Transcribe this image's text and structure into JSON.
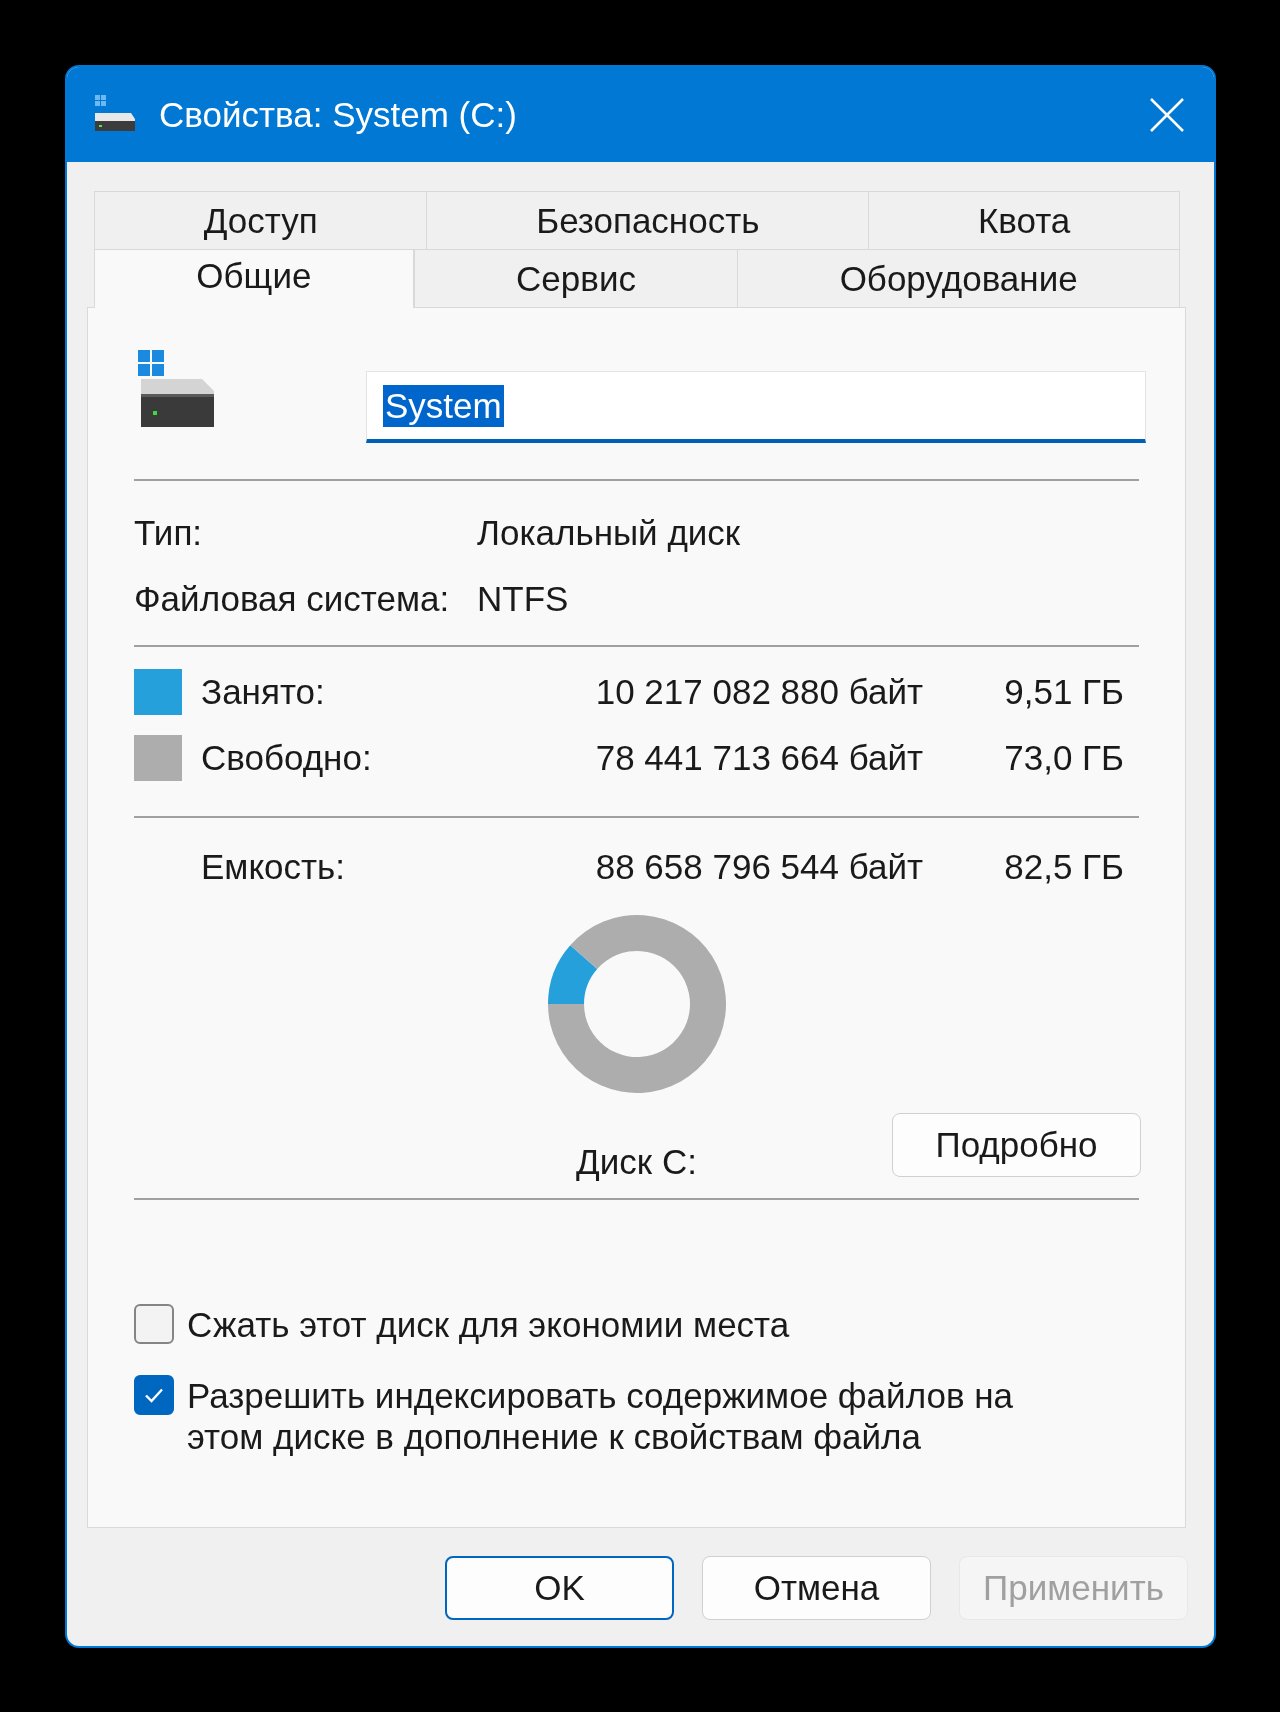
{
  "window": {
    "title": "Свойства: System (C:)"
  },
  "tab_rows": [
    {
      "tabs": [
        {
          "label": "Доступ",
          "selected": false
        },
        {
          "label": "Безопасность",
          "selected": false
        },
        {
          "label": "Квота",
          "selected": false
        }
      ]
    },
    {
      "tabs": [
        {
          "label": "Общие",
          "selected": true
        },
        {
          "label": "Сервис",
          "selected": false
        },
        {
          "label": "Оборудование",
          "selected": false
        }
      ]
    }
  ],
  "name_field": {
    "value": "System",
    "text_selected": true
  },
  "info": [
    {
      "label": "Тип:",
      "value": "Локальный диск"
    },
    {
      "label": "Файловая система:",
      "value": "NTFS"
    }
  ],
  "usage": [
    {
      "label": "Занято:",
      "bytes": "10 217 082 880 байт",
      "size": "9,51 ГБ",
      "color": "#26a0da"
    },
    {
      "label": "Свободно:",
      "bytes": "78 441 713 664 байт",
      "size": "73,0 ГБ",
      "color": "#adadad"
    }
  ],
  "capacity": {
    "label": "Емкость:",
    "bytes": "88 658 796 544 байт",
    "size": "82,5 ГБ"
  },
  "disk_chart": {
    "chart_data": {
      "type": "donut",
      "title": "Диск C:",
      "values": [
        11.5,
        88.5
      ]
    }
  },
  "details_button": {
    "label": "Подробно"
  },
  "options": [
    {
      "label": "Сжать этот диск для экономии места",
      "checked": false
    },
    {
      "label": "Разрешить индексировать содержимое файлов на этом диске в дополнение к свойствам файла",
      "checked": true
    }
  ],
  "buttons": [
    {
      "label": "OK",
      "default": true,
      "disabled": false
    },
    {
      "label": "Отмена",
      "default": false,
      "disabled": false
    },
    {
      "label": "Применить",
      "default": false,
      "disabled": true
    }
  ]
}
